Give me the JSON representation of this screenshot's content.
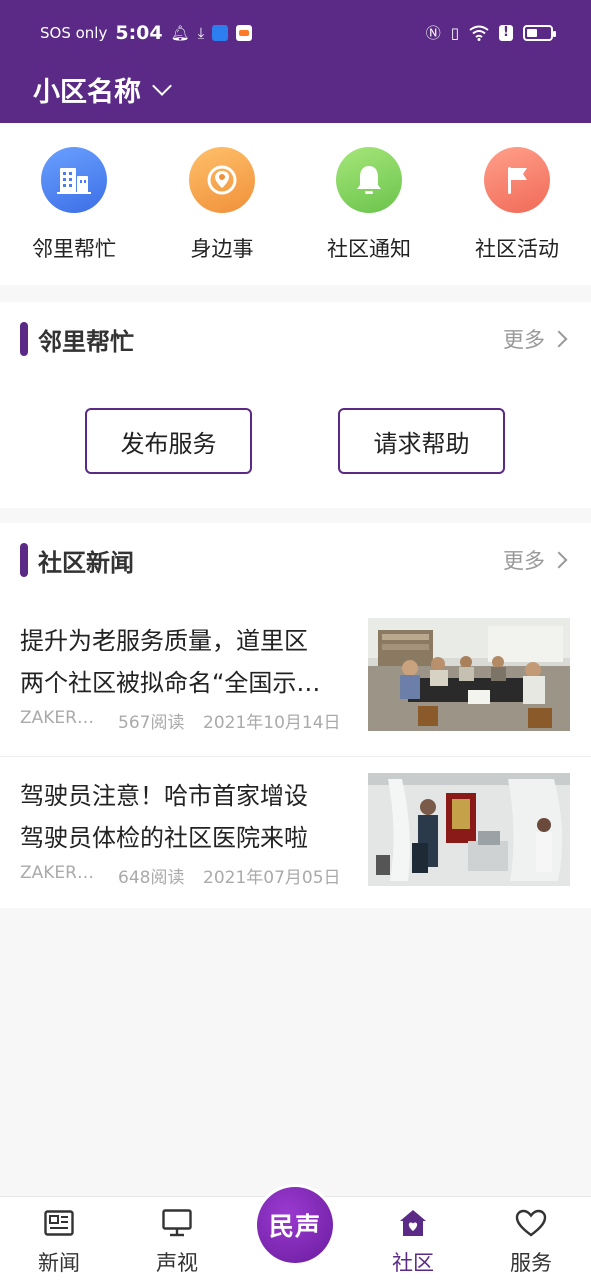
{
  "status_bar": {
    "carrier": "SOS only",
    "time": "5:04",
    "right_icons": [
      "nfc-icon",
      "vibrate-icon",
      "wifi-icon",
      "alert-icon",
      "battery-icon"
    ]
  },
  "header": {
    "community_name": "小区名称"
  },
  "quick_menu": [
    {
      "label": "邻里帮忙",
      "icon": "building-icon",
      "color": "#4a7ef0"
    },
    {
      "label": "身边事",
      "icon": "location-icon",
      "color": "#f5a04a"
    },
    {
      "label": "社区通知",
      "icon": "bell-icon",
      "color": "#88d45e"
    },
    {
      "label": "社区活动",
      "icon": "flag-icon",
      "color": "#f27a66"
    }
  ],
  "help_section": {
    "title": "邻里帮忙",
    "more": "更多",
    "buttons": [
      "发布服务",
      "请求帮助"
    ]
  },
  "news_section": {
    "title": "社区新闻",
    "more": "更多",
    "items": [
      {
        "title_line1": "提升为老服务质量，道里区",
        "title_line2": "两个社区被拟命名“全国示…",
        "source": "ZAKER…",
        "reads": "567阅读",
        "date": "2021年10月14日"
      },
      {
        "title_line1": "驾驶员注意！哈市首家增设",
        "title_line2": "驾驶员体检的社区医院来啦",
        "source": "ZAKER…",
        "reads": "648阅读",
        "date": "2021年07月05日"
      }
    ]
  },
  "tabbar": {
    "tabs": [
      {
        "label": "新闻",
        "icon": "newspaper-icon"
      },
      {
        "label": "声视",
        "icon": "monitor-icon"
      },
      {
        "label": "社区",
        "icon": "home-heart-icon",
        "active": true
      },
      {
        "label": "服务",
        "icon": "heart-icon"
      }
    ],
    "center_label": "民声"
  },
  "colors": {
    "primary": "#5a2a86",
    "background": "#f7f7f7"
  }
}
